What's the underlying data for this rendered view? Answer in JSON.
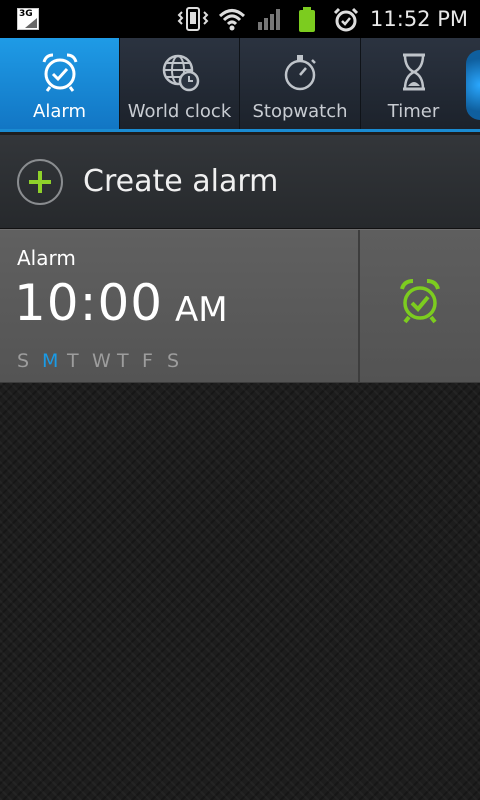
{
  "status_bar": {
    "network_label": "3G",
    "time": "11:52 PM",
    "icons": [
      "network-3g-icon",
      "vibrate-icon",
      "wifi-icon",
      "signal-icon",
      "battery-icon",
      "alarm-status-icon"
    ]
  },
  "tabs": [
    {
      "label": "Alarm",
      "icon": "alarm-clock-icon",
      "active": true
    },
    {
      "label": "World clock",
      "icon": "globe-clock-icon",
      "active": false
    },
    {
      "label": "Stopwatch",
      "icon": "stopwatch-icon",
      "active": false
    },
    {
      "label": "Timer",
      "icon": "hourglass-icon",
      "active": false
    }
  ],
  "create": {
    "label": "Create alarm"
  },
  "alarms": [
    {
      "name": "Alarm",
      "time": "10:00",
      "ampm": "AM",
      "days": [
        "S",
        "M",
        "T",
        "W",
        "T",
        "F",
        "S"
      ],
      "active_days": [
        1
      ],
      "enabled": true
    }
  ],
  "colors": {
    "accent_blue": "#1a9be6",
    "alarm_on_green": "#7ccc1f",
    "plus_green": "#8fd12a"
  }
}
